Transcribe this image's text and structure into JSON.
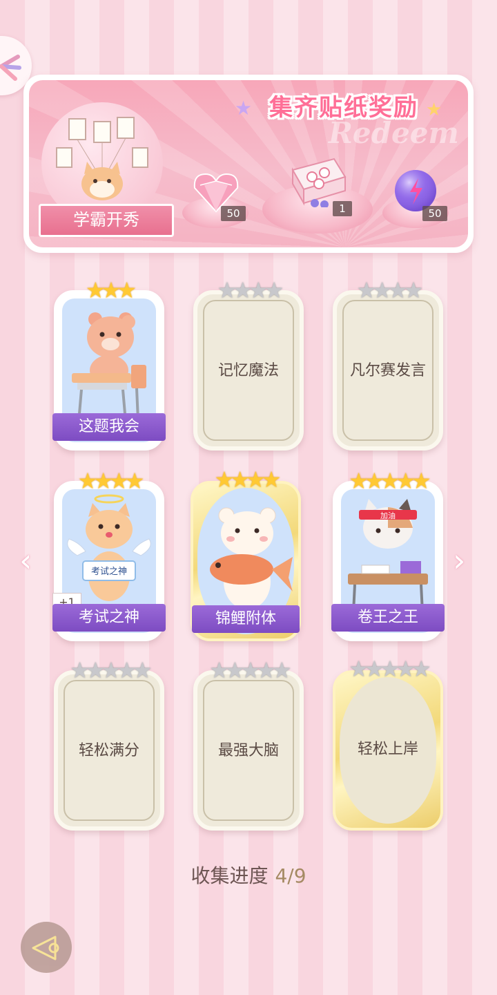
{
  "banner": {
    "title": "集齐贴纸奖励",
    "watermark": "Redeem",
    "badge_label": "学霸开秀",
    "rewards": [
      {
        "icon": "pink-heart-gem-icon",
        "count": "50"
      },
      {
        "icon": "gift-box-icon",
        "count": "1"
      },
      {
        "icon": "purple-energy-orb-icon",
        "count": "50"
      }
    ]
  },
  "cards": [
    {
      "name": "这题我会",
      "state": "unlocked",
      "stars": "★★★",
      "star_type": "gold"
    },
    {
      "name": "记忆魔法",
      "state": "locked",
      "stars": "★★★★",
      "star_type": "silver"
    },
    {
      "name": "凡尔赛发言",
      "state": "locked",
      "stars": "★★★★",
      "star_type": "silver"
    },
    {
      "name": "考试之神",
      "state": "unlocked",
      "stars": "★★★★",
      "star_type": "gold",
      "badge": "+1",
      "sign_text": "考试之神"
    },
    {
      "name": "锦鲤附体",
      "state": "unlocked-gold",
      "stars": "★★★★",
      "star_type": "gold"
    },
    {
      "name": "卷王之王",
      "state": "unlocked",
      "stars": "★★★★★",
      "star_type": "gold",
      "headband_text": "加油"
    },
    {
      "name": "轻松满分",
      "state": "locked",
      "stars": "★★★★★",
      "star_type": "silver"
    },
    {
      "name": "最强大脑",
      "state": "locked",
      "stars": "★★★★★",
      "star_type": "silver"
    },
    {
      "name": "轻松上岸",
      "state": "locked-gold",
      "stars": "★★★★★",
      "star_type": "silver"
    }
  ],
  "progress": {
    "label": "收集进度",
    "value": "4/9"
  },
  "colors": {
    "accent_pink": "#ff6f97",
    "label_purple": "#7d4cc2",
    "star_gold": "#ffc934",
    "star_silver": "#c8c8cc"
  }
}
